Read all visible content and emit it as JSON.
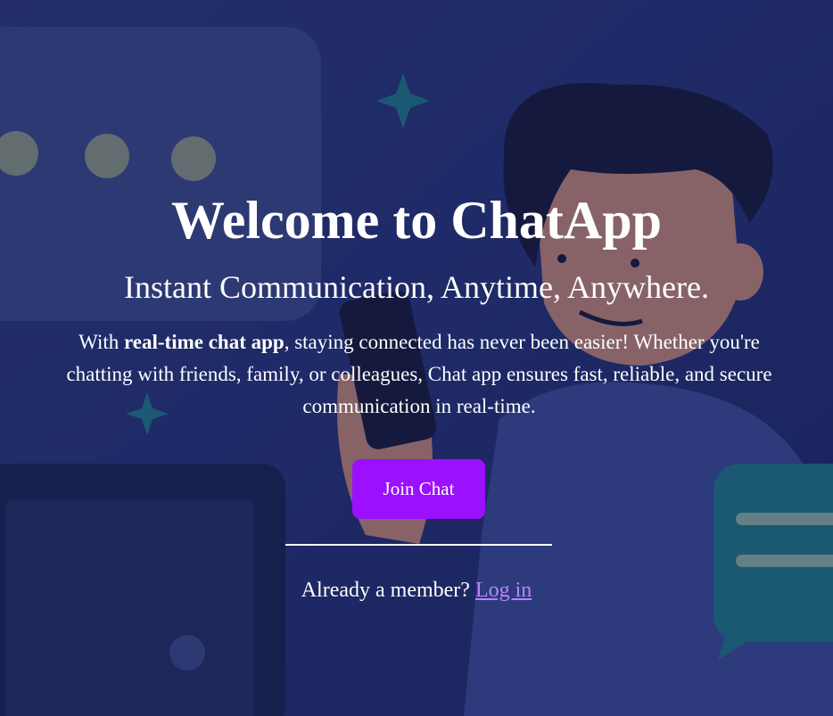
{
  "hero": {
    "title": "Welcome to ChatApp",
    "subtitle": "Instant Communication, Anytime, Anywhere.",
    "description_prefix": "With ",
    "description_bold": "real-time chat app",
    "description_suffix": ", staying connected has never been easier! Whether you're chatting with friends, family, or colleagues, Chat app ensures fast, reliable, and secure communication in real-time."
  },
  "cta": {
    "join_label": "Join Chat",
    "member_prompt": "Already a member? ",
    "login_label": "Log in"
  },
  "colors": {
    "accent": "#9b10ff",
    "link": "#b884ff",
    "background": "#1f2b6a"
  },
  "background_illustration": "person-texting-with-chat-bubbles"
}
